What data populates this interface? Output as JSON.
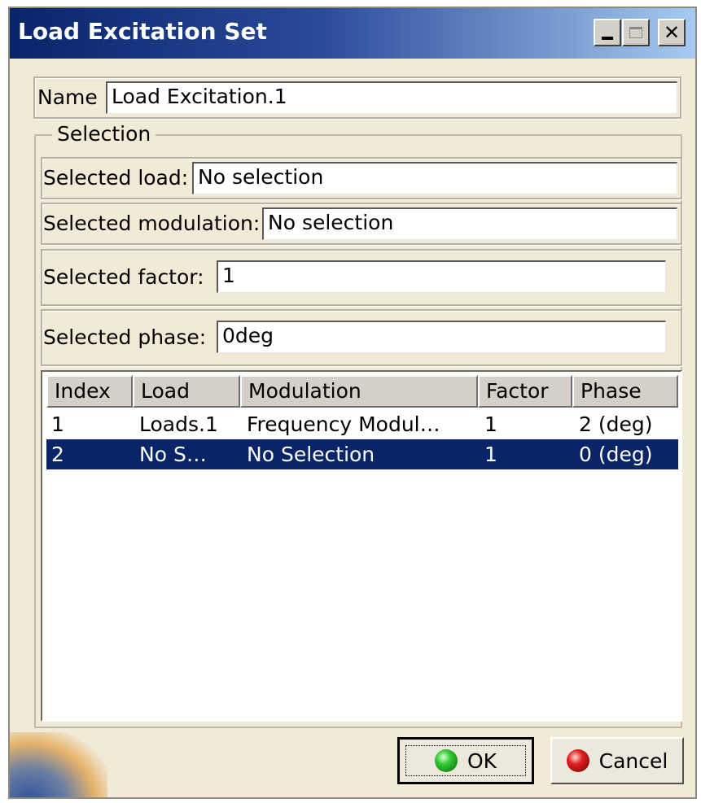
{
  "window": {
    "title": "Load Excitation Set"
  },
  "name": {
    "label": "Name",
    "value": "Load Excitation.1"
  },
  "selection": {
    "legend": "Selection",
    "selected_load": {
      "label": "Selected load:",
      "value": "No selection"
    },
    "selected_modulation": {
      "label": "Selected modulation:",
      "value": "No selection"
    },
    "selected_factor": {
      "label": "Selected factor:",
      "value": "1"
    },
    "selected_phase": {
      "label": "Selected phase:",
      "value": "0deg"
    }
  },
  "table": {
    "columns": [
      "Index",
      "Load",
      "Modulation",
      "Factor",
      "Phase"
    ],
    "rows": [
      [
        "1",
        "Loads.1",
        "Frequency Modul…",
        "1",
        "2 (deg)"
      ],
      [
        "2",
        "No S…",
        "No Selection",
        "1",
        "0 (deg)"
      ]
    ],
    "selected_row": 2
  },
  "buttons": {
    "ok": "OK",
    "cancel": "Cancel"
  },
  "icons": {
    "minimize": "minimize-icon",
    "maximize": "maximize-icon",
    "close": "close-icon",
    "ok": "green-orb-icon",
    "cancel": "red-orb-icon"
  },
  "colors": {
    "title_bar": "#0a246a",
    "dialog_background": "#f1ead6",
    "selection_highlight": "#0a246a"
  }
}
